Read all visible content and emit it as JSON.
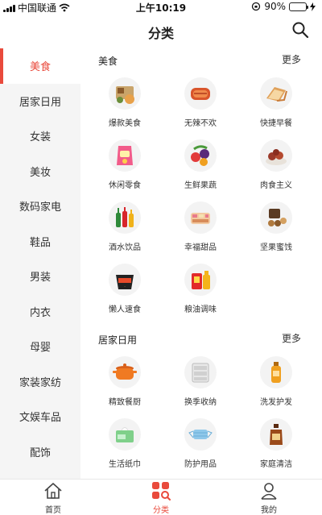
{
  "status_bar": {
    "carrier": "中国联通",
    "time": "上午10:19",
    "battery_pct": "90%",
    "battery_level": 0.9
  },
  "header": {
    "title": "分类"
  },
  "sidebar": {
    "items": [
      {
        "label": "美食",
        "active": true
      },
      {
        "label": "居家日用"
      },
      {
        "label": "女装"
      },
      {
        "label": "美妆"
      },
      {
        "label": "数码家电"
      },
      {
        "label": "鞋品"
      },
      {
        "label": "男装"
      },
      {
        "label": "内衣"
      },
      {
        "label": "母婴"
      },
      {
        "label": "家装家纺"
      },
      {
        "label": "文娱车品"
      },
      {
        "label": "配饰"
      }
    ]
  },
  "sections": [
    {
      "title": "美食",
      "more": "更多",
      "items": [
        {
          "label": "爆款美食",
          "icon": "snack-box-icon"
        },
        {
          "label": "无辣不欢",
          "icon": "spicy-meat-icon"
        },
        {
          "label": "快捷早餐",
          "icon": "bread-icon"
        },
        {
          "label": "休闲零食",
          "icon": "snack-bag-icon"
        },
        {
          "label": "生鲜果蔬",
          "icon": "fruit-icon"
        },
        {
          "label": "肉食主义",
          "icon": "meat-icon"
        },
        {
          "label": "酒水饮品",
          "icon": "bottles-icon"
        },
        {
          "label": "幸福甜品",
          "icon": "dessert-icon"
        },
        {
          "label": "坚果蜜饯",
          "icon": "nuts-icon"
        },
        {
          "label": "懒人速食",
          "icon": "instant-food-icon"
        },
        {
          "label": "粮油调味",
          "icon": "oil-icon"
        }
      ]
    },
    {
      "title": "居家日用",
      "more": "更多",
      "items": [
        {
          "label": "精致餐厨",
          "icon": "pot-icon"
        },
        {
          "label": "换季收纳",
          "icon": "storage-box-icon"
        },
        {
          "label": "洗发护发",
          "icon": "shampoo-icon"
        },
        {
          "label": "生活纸巾",
          "icon": "tissue-icon"
        },
        {
          "label": "防护用品",
          "icon": "mask-icon"
        },
        {
          "label": "家庭清洁",
          "icon": "cleaner-icon"
        }
      ]
    }
  ],
  "tabbar": {
    "items": [
      {
        "label": "首页",
        "icon": "home-icon"
      },
      {
        "label": "分类",
        "icon": "category-icon",
        "active": true
      },
      {
        "label": "我的",
        "icon": "profile-icon"
      }
    ]
  },
  "colors": {
    "accent": "#e94a3c",
    "sidebar_bg": "#f5f5f5"
  }
}
